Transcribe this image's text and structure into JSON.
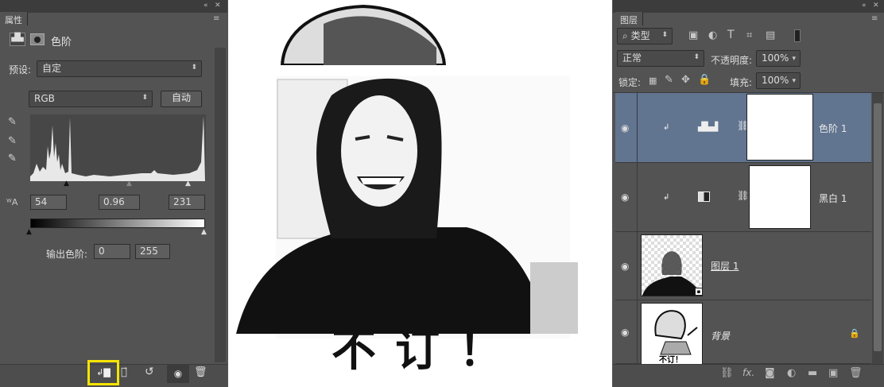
{
  "properties": {
    "tab": "属性",
    "title": "色阶",
    "preset_label": "预设:",
    "preset_value": "自定",
    "channel": "RGB",
    "auto_button": "自动",
    "input_black": "54",
    "input_gamma": "0.96",
    "input_white": "231",
    "output_label": "输出色阶:",
    "output_black": "0",
    "output_white": "255"
  },
  "layers": {
    "tab": "图层",
    "filter_kind": "类型",
    "blend_mode": "正常",
    "opacity_label": "不透明度:",
    "opacity_value": "100%",
    "lock_label": "锁定:",
    "fill_label": "填充:",
    "fill_value": "100%",
    "items": [
      {
        "name": "色阶 1",
        "type": "adjustment-levels",
        "selected": true
      },
      {
        "name": "黑白 1",
        "type": "adjustment-bw",
        "selected": false
      },
      {
        "name": "图层 1",
        "type": "pixel",
        "selected": false
      },
      {
        "name": "背景",
        "type": "background",
        "selected": false,
        "locked": true
      }
    ]
  },
  "canvas": {
    "caption": "不订！",
    "background_thumb_caption": "不订！"
  },
  "colors": {
    "panel_bg": "#535353",
    "selected_layer": "#617490",
    "highlight_box": "#f5e400"
  }
}
